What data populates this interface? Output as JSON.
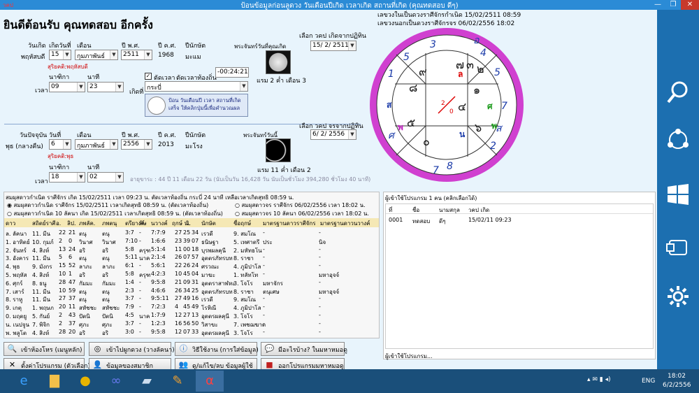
{
  "titlebar": {
    "app_tag": "วคป",
    "title": "ป้อนข้อมูลก่อนลูดวง วันเดือนปีเกิด เวลาเกิด สถานที่เกิด (คุณทดสอบ ดีๆ)",
    "min": "—",
    "max": "❐",
    "close": "✕"
  },
  "welcome": "ยินดีต้อนรับ  คุณทดสอบ  อีกครั้ง",
  "birth": {
    "col_day": "วันเกิด",
    "col_date": "เกิดวันที่",
    "col_month": "เดือน",
    "col_year": "ปี พ.ศ.",
    "col_year_ad": "ปี ค.ศ.",
    "col_zodiac": "ปีนักษัต",
    "weekday": "พฤหัสบดี",
    "date": "15",
    "month": "กุมภาพันธ์",
    "year": "2511",
    "year_ad": "1968",
    "zodiac_year": "มะแม",
    "note": "สุริยคติ:พฤหัสบดี",
    "moon_label": "พระจันทร์วันที่คุณเกิด",
    "moon_phase": "แรม 2 ค่ำ เดือน 3",
    "hdr_nalika": "นาฑิกา",
    "hdr_minute": "นาที",
    "time_label": "เวลา",
    "hour": "09",
    "minute": "23",
    "place_label": "เกิดที่",
    "place": "กระบี่",
    "chk_label": "ตัดเวลา",
    "local_label": "ตัดเวลาท้องถิ่น",
    "local_offset": "-00:24:21",
    "lookup_label": "เลือก วคป เกิดจากปฏิทิน",
    "lookup_value": "15/ 2/ 2511",
    "help_btn": "ป้อน วันเดือนปี เวลา สถานที่เกิด เสร็จ ให้คลิกปุ่มนี้เพื่อคำนวณผล"
  },
  "today": {
    "col_day": "วันปัจจุบัน",
    "col_date": "วันที่",
    "col_month": "เดือน",
    "col_year": "ปี พ.ศ.",
    "col_year_ad": "ปี ค.ศ.",
    "col_zodiac": "ปีนักษัต",
    "weekday": "พุธ (กลางคืน)",
    "date": "6",
    "month": "กุมภาพันธ์",
    "year": "2556",
    "year_ad": "2013",
    "zodiac_year": "มะโรง",
    "note": "สุริยคติ:พุธ",
    "moon_label": "พระจันทร์วันนี้",
    "moon_phase": "แรม 11 ค่ำ เดือน 2",
    "hdr_nalika": "นาฑิกา",
    "hdr_minute": "นาที",
    "time_label": "เวลา",
    "hour": "18",
    "minute": "02",
    "age": "อายุขาระ : 44 ปี 11 เดือน 22 วัน (นับเป็นวัน 16,428 วัน นับเป็นชั่วโมง 394,280 ชั่วโมง 40 นาที)",
    "lookup_label": "เลือก วคป จรจากปฏิทิน",
    "lookup_value": "6/ 2/ 2556"
  },
  "right_info": {
    "line1": "เลขวงในเป็นดวงราศีจักรกำเนิด 15/02/2511 08:59",
    "line2": "เลขวงนอกเป็นดวงราศีจักรจร 06/02/2556 18:02"
  },
  "chart_center": {
    "top": "2",
    "bottom": "0"
  },
  "chart_outer_numbers": [
    "5",
    "3",
    "4",
    "5",
    "1",
    "7",
    "2",
    "8",
    "7",
    "ศ",
    "อ",
    "ส"
  ],
  "chart_inner_numbers": [
    "๙",
    "๗",
    "๔",
    "๒",
    "๑",
    "๕",
    "๖",
    "๓",
    "๐",
    "๘"
  ],
  "chart_marks": [
    "ล",
    "พ",
    "น",
    "ศ",
    "พ",
    "ส"
  ],
  "panel1": {
    "header": "สมผุสดาวกำเนิด ราศีจักร เกิด 15/02/2511 เวลา 09:23 น. ตัดเวลาท้องถิ่น กระบี่ 24 นาที เหลือเวลาเกิดสุทธิ 08:59 น.",
    "radio1": "สมผุสดาวกำเนิด ราศีจักร 15/02/2511 เวลาเกิดสุทธิ 08:59 น. (ตัดเวลาท้องถิ่น)",
    "radio2": "สมผุสดาวจร ราศีจักร 06/02/2556 เวลา 18:02 น.",
    "radio3": "สมผุสดาวกำเนิด 10 ลัคนา เกิด 15/02/2511 เวลาเกิดสุทธิ 08:59 น. (ตัดเวลาท้องถิ่น)",
    "radio4": "สมผุสดาวจร 10 ลัคนา 06/02/2556 เวลา 18:02 น.",
    "columns": [
      "ดาว",
      "สถิตย์ราศี",
      "อ.",
      "ลิป.",
      "ภพลัค.",
      "ภพตนุ",
      "ตรียางค์",
      "พิษ",
      "นวางค์",
      "ฤกษ์ น.",
      "วิ.",
      "นักษัต",
      "ชื่อฤกษ์",
      "มาตรฐานดาวราศีจักร",
      "มาตรฐานดาวนวางค์"
    ],
    "rows": [
      [
        "ล. ลัคนา",
        "11. มีน",
        "22",
        "21",
        "ตนุ",
        "ตนุ",
        "3:7",
        "-",
        "7:7:9",
        "27",
        "25",
        "34",
        "เรวดี",
        "9. สมโณ",
        "-",
        "-"
      ],
      [
        "1. อาทิตย์",
        "10. กุมภ์",
        "2",
        "0",
        "วินาศ",
        "วินาศ",
        "7:10",
        "-",
        "1:6:6",
        "23",
        "39",
        "07",
        "ธนิษฐา",
        "5. เทศาตรี",
        "ประ",
        "นิจ"
      ],
      [
        "2. จันทร์",
        "4. สิงห์",
        "13",
        "24",
        "อริ",
        "อริ",
        "5:8",
        "ครุฑ",
        "5:1:4",
        "11",
        "00",
        "18",
        "บุรพผลคุนี",
        "2. มหัทธโน",
        "-",
        "-"
      ],
      [
        "3. อังคาร",
        "11. มีน",
        "5",
        "6",
        "ตนุ",
        "ตนุ",
        "5:11",
        "นาค",
        "2:1:4",
        "26",
        "07",
        "57",
        "อุตตรภัทรบท",
        "8. ราชา",
        "-",
        "-"
      ],
      [
        "4. พุธ",
        "9. มังกร",
        "15",
        "52",
        "ลาภะ",
        "ลาภะ",
        "6:1",
        "-",
        "5:6:1",
        "22",
        "26",
        "24",
        "ศรวณะ",
        "4. ภูมิปาโล",
        "-",
        "-"
      ],
      [
        "5. พฤหัส",
        "4. สิงห์",
        "10",
        "1",
        "อริ",
        "อริ",
        "5:8",
        "ครุฑ",
        "4:2:3",
        "10",
        "45",
        "04",
        "มาฆะ",
        "1. ทลัทโท",
        "-",
        "มหาอุจจ์"
      ],
      [
        "6. ศุกร์",
        "8. ธนู",
        "28",
        "47",
        "กัมมะ",
        "กัมมะ",
        "1:4",
        "-",
        "9:5:8",
        "21",
        "09",
        "31",
        "อุตตราสาฬหะ",
        "3. โจโร",
        "มหาจักร",
        "-"
      ],
      [
        "7. เสาร์",
        "11. มีน",
        "10",
        "59",
        "ตนุ",
        "ตนุ",
        "2:3",
        "-",
        "4:6:6",
        "26",
        "34",
        "25",
        "อุตตรภัทรบท",
        "8. ราชา",
        "ตนุเศษ",
        "มหาอุจจ์"
      ],
      [
        "8. ราหู",
        "11. มีน",
        "27",
        "37",
        "ตนุ",
        "ตนุ",
        "3:7",
        "-",
        "9:5:11",
        "27",
        "49",
        "16",
        "เรวดี",
        "9. สมโณ",
        "-",
        "-"
      ],
      [
        "9. เกตุ",
        "1. พฤษภ",
        "20",
        "11",
        "สหัชชะ",
        "สหัชชะ",
        "7:9",
        "-",
        "7:2:3",
        "4",
        "45",
        "49",
        "โรหิณี",
        "4. ภูมิปาโล",
        "-",
        "-"
      ],
      [
        "0. มฤตยู",
        "5. กันย์",
        "2",
        "43",
        "ปัตนิ",
        "ปัตนิ",
        "4:5",
        "นาค",
        "1:7:9",
        "12",
        "27",
        "13",
        "อุตตรผลคุนี",
        "3. โจโร",
        "-",
        "-"
      ],
      [
        "น. เนปจูน",
        "7. พิจิก",
        "2",
        "37",
        "ศุภะ",
        "ศุภะ",
        "3:7",
        "-",
        "1:2:3",
        "16",
        "56",
        "50",
        "วิสาขะ",
        "7. เพชฌฆาต",
        "-",
        "-"
      ],
      [
        "พ. พลูโต",
        "4. สิงห์",
        "28",
        "20",
        "อริ",
        "อริ",
        "3:0",
        "-",
        "9:5:8",
        "12",
        "07",
        "33",
        "อุตตรผลคุนี",
        "3. โจโร",
        "-",
        "-"
      ]
    ]
  },
  "panel2": {
    "header": "ผู้เข้าใช้โปรแกรม 1 คน (คลิกเลือกได้)",
    "columns": [
      "ที่",
      "ชื่อ",
      "นามสกุล",
      "วคป เกิด"
    ],
    "row": [
      "0001",
      "ทดสอบ",
      "ดีๆ",
      "15/02/11 09:23"
    ],
    "footer": "ผู้เข้าใช้โปรแกรม..."
  },
  "buttons": {
    "b1": "เข้าห้องโหร (เมนูหลัก)",
    "b2": "เข้าไปผูกดวง (วางลัคนา)",
    "b3": "วิธีใช้งาน (การใส่ข้อมูล)",
    "b4": "มีอะไรบ้าง? ในมหาหมอดู",
    "b5": "ตั้งค่าโปรแกรม (ตัวเลือก)",
    "b6": "ข้อมูลของสมาชิก",
    "b7": "ดู/แก้ไข/ลบ ข้อมูลผู้ใช้",
    "b8": "ออกโปรแกรมมหาหมอดู"
  },
  "taskbar": {
    "lang": "ENG",
    "time": "18:02",
    "date": "6/2/2556"
  }
}
